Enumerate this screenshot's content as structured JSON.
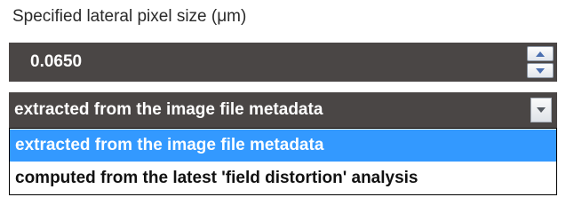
{
  "label": "Specified lateral pixel size (μm)",
  "spinbox": {
    "value": "0.0650",
    "up_icon": "spin-up-arrow",
    "down_icon": "spin-down-arrow"
  },
  "combo": {
    "selected": "extracted from the image file metadata",
    "arrow_icon": "chevron-down"
  },
  "dropdown": {
    "options": [
      "extracted from the image file metadata",
      "computed from the latest 'field distortion' analysis"
    ],
    "highlighted_index": 0
  },
  "colors": {
    "field_background": "#4a4645",
    "highlight": "#3399ff",
    "field_text": "#ffffff"
  }
}
